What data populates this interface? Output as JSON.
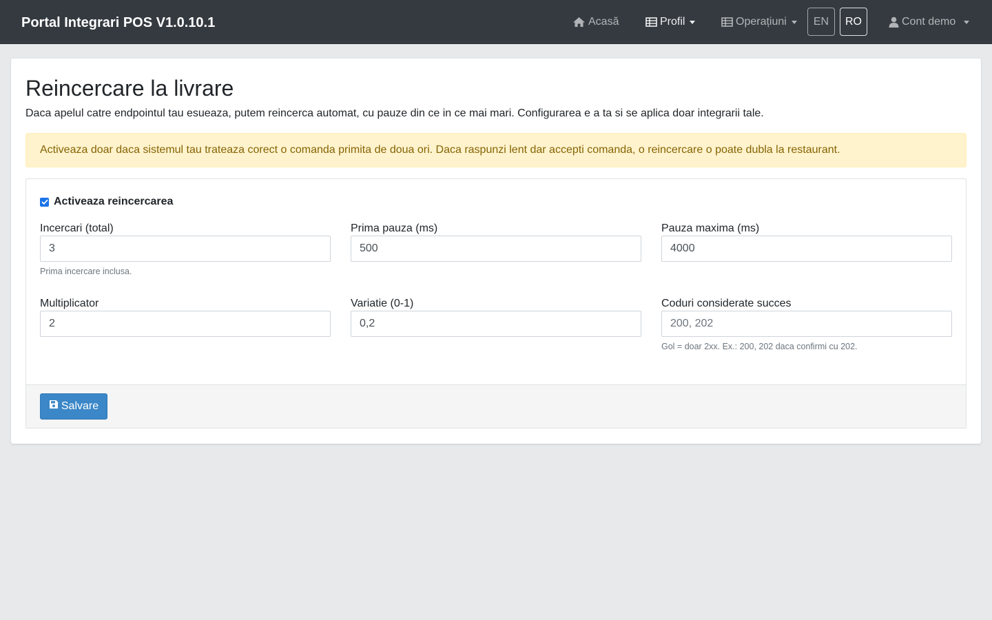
{
  "navbar": {
    "brand": "Portal Integrari POS V1.0.10.1",
    "home": {
      "label": "Acasă",
      "icon": "home-icon"
    },
    "profile": {
      "label": "Profil",
      "icon": "table-icon"
    },
    "operations": {
      "label": "Operațiuni",
      "icon": "table-icon"
    },
    "languages": [
      "EN",
      "RO"
    ],
    "active_language": "RO",
    "account": {
      "label": "Cont demo",
      "icon": "user-icon"
    }
  },
  "page": {
    "title": "Reincercare la livrare",
    "description": "Daca apelul catre endpointul tau esueaza, putem reincerca automat, cu pauze din ce in ce mai mari. Configurarea e a ta si se aplica doar integrarii tale.",
    "warning": "Activeaza doar daca sistemul tau trateaza corect o comanda primita de doua ori. Daca raspunzi lent dar accepti comanda, o reincercare o poate dubla la restaurant."
  },
  "form": {
    "enable_label": "Activeaza reincercarea",
    "enabled": true,
    "attempts": {
      "label": "Incercari (total)",
      "value": "3",
      "help": "Prima incercare inclusa."
    },
    "first_pause": {
      "label": "Prima pauza (ms)",
      "value": "500"
    },
    "max_pause": {
      "label": "Pauza maxima (ms)",
      "value": "4000"
    },
    "multiplier": {
      "label": "Multiplicator",
      "value": "2"
    },
    "jitter": {
      "label": "Variatie (0-1)",
      "value": "0,2"
    },
    "success_codes": {
      "label": "Coduri considerate succes",
      "placeholder": "200, 202",
      "value": "",
      "help": "Gol = doar 2xx. Ex.: 200, 202 daca confirmi cu 202."
    },
    "save_label": "Salvare"
  },
  "colors": {
    "navbar_bg": "#343a40",
    "alert_bg": "#fff3cd",
    "alert_text": "#856404",
    "primary": "#3b87c8"
  }
}
